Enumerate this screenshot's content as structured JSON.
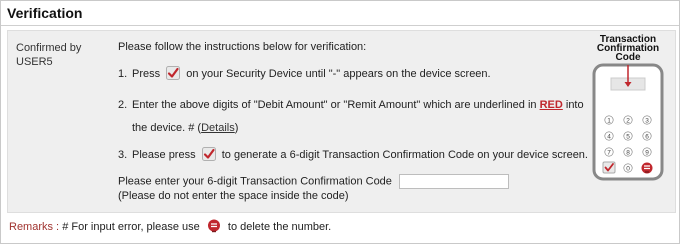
{
  "header": {
    "title": "Verification"
  },
  "left": {
    "label": "Confirmed by",
    "user": "USER5"
  },
  "intro": "Please follow the instructions below for verification:",
  "steps": [
    {
      "num": "1.",
      "pre": "Press",
      "post": "on your Security Device until \"-\" appears on the device screen."
    },
    {
      "num": "2.",
      "pre": "Enter the above digits of \"Debit Amount\" or \"Remit Amount\" which are underlined in",
      "red": "RED",
      "mid": "into the device. #",
      "link": "Details"
    },
    {
      "num": "3.",
      "pre": "Please press",
      "post": "to generate a 6-digit Transaction Confirmation Code on your device screen."
    }
  ],
  "code_prompt": "Please enter your 6-digit Transaction Confirmation Code",
  "code_note": "(Please do not enter the space inside the code)",
  "code_value": "",
  "device": {
    "title_line1": "Transaction",
    "title_line2": "Confirmation",
    "title_line3": "Code",
    "keys": [
      "1",
      "2",
      "3",
      "4",
      "5",
      "6",
      "7",
      "8",
      "9",
      "0"
    ]
  },
  "footer": {
    "remarks_label": "Remarks :",
    "pre": "# For input error, please use",
    "post": "to delete the number."
  },
  "colors": {
    "accent_red": "#c0272d",
    "panel_bg": "#efefef",
    "border": "#c9c9c9"
  }
}
